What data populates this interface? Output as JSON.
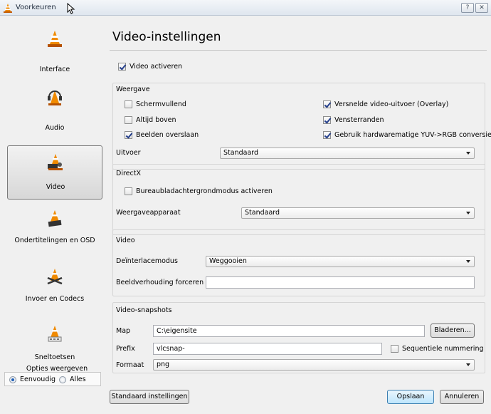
{
  "window": {
    "title": "Voorkeuren",
    "help_label": "?",
    "close_label": "✕"
  },
  "sidebar": {
    "items": [
      {
        "label": "Interface",
        "icon": "cone-icon"
      },
      {
        "label": "Audio",
        "icon": "cone-headphones-icon"
      },
      {
        "label": "Video",
        "icon": "cone-video-icon"
      },
      {
        "label": "Ondertitelingen en OSD",
        "icon": "cone-subtitles-icon"
      },
      {
        "label": "Invoer en Codecs",
        "icon": "cone-codecs-icon"
      },
      {
        "label": "Sneltoetsen",
        "icon": "cone-hotkeys-icon"
      }
    ],
    "selected": "Video",
    "view_options_title": "Opties weergeven",
    "view_simple": "Eenvoudig",
    "view_all": "Alles"
  },
  "main": {
    "heading": "Video-instellingen",
    "enable_video": "Video activeren",
    "display": {
      "title": "Weergave",
      "fullscreen": "Schermvullend",
      "always_on_top": "Altijd boven",
      "skip_frames": "Beelden overslaan",
      "accelerated": "Versnelde video-uitvoer (Overlay)",
      "window_decorations": "Vensterranden",
      "hw_yuv": "Gebruik hardwarematige YUV->RGB conversie",
      "output_label": "Uitvoer",
      "output_value": "Standaard"
    },
    "directx": {
      "title": "DirectX",
      "wallpaper": "Bureaubladachtergrondmodus activeren",
      "device_label": "Weergaveapparaat",
      "device_value": "Standaard"
    },
    "video": {
      "title": "Video",
      "deinterlace_label": "Deïnterlacemodus",
      "deinterlace_value": "Weggooien",
      "aspect_label": "Beeldverhouding forceren",
      "aspect_value": ""
    },
    "snapshots": {
      "title": "Video-snapshots",
      "dir_label": "Map",
      "dir_value": "C:\\eigensite",
      "browse": "Bladeren...",
      "prefix_label": "Prefix",
      "prefix_value": "vlcsnap-",
      "sequential": "Sequentiele nummering",
      "format_label": "Formaat",
      "format_value": "png"
    }
  },
  "footer": {
    "reset": "Standaard instellingen",
    "save": "Opslaan",
    "cancel": "Annuleren"
  },
  "colors": {
    "cone_orange": "#f08a00",
    "selection_border": "#7a7a7a",
    "primary_button": "#bee6fd"
  }
}
